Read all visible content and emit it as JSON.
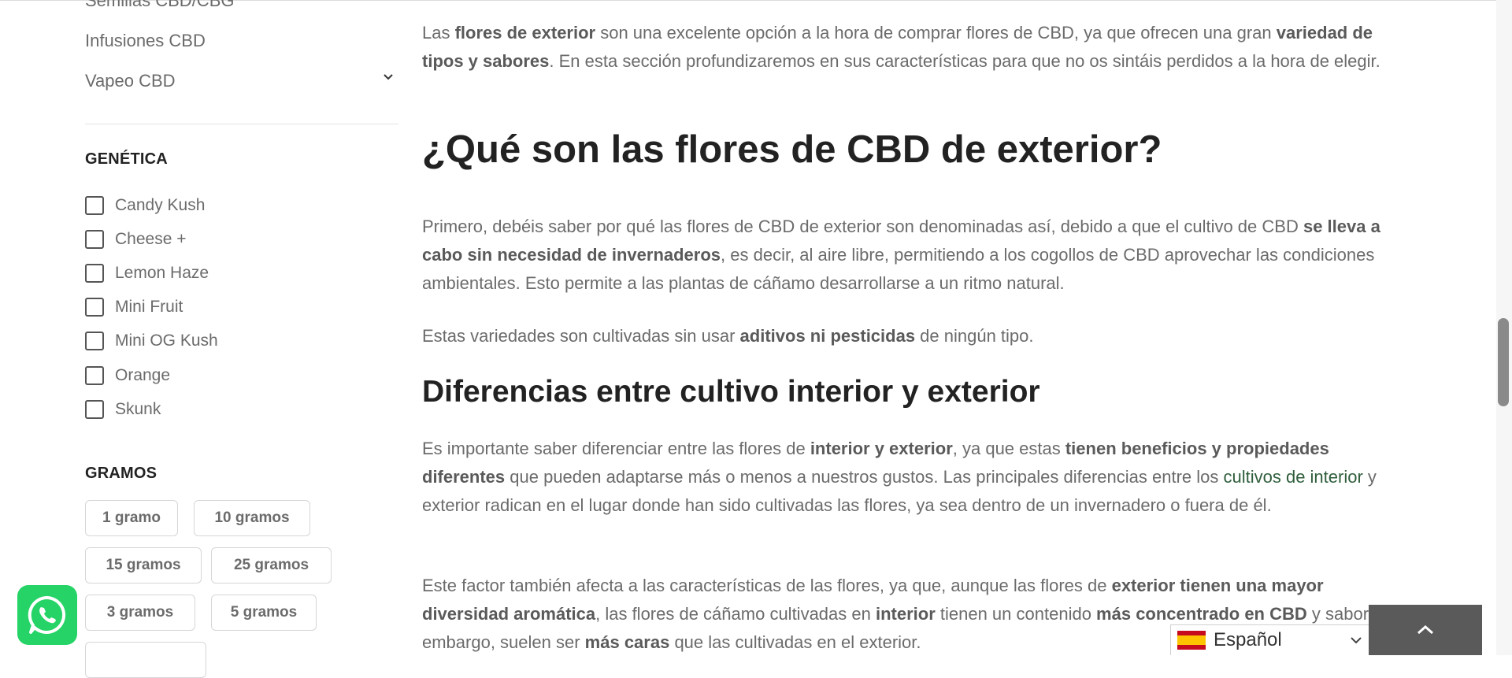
{
  "sidebar": {
    "categories": [
      {
        "label": "Semillas CBD/CBG"
      },
      {
        "label": "Infusiones CBD"
      },
      {
        "label": "Vapeo CBD"
      }
    ],
    "genetica": {
      "title": "GENÉTICA",
      "options": [
        "Candy Kush",
        "Cheese +",
        "Lemon Haze",
        "Mini Fruit",
        "Mini OG Kush",
        "Orange",
        "Skunk"
      ]
    },
    "gramos": {
      "title": "GRAMOS",
      "chips": [
        "1 gramo",
        "10 gramos",
        "15 gramos",
        "25 gramos",
        "3 gramos",
        "5 gramos"
      ]
    }
  },
  "content": {
    "intro": {
      "t1": "Las ",
      "b1": "flores de exterior",
      "t2": " son una excelente opción a la hora de comprar flores de CBD, ya que ofrecen una gran ",
      "b2": "variedad de tipos y sabores",
      "t3": ". En esta sección profundizaremos en sus características para que no os sintáis perdidos a la hora de elegir."
    },
    "h_que_son": "¿Qué son las flores de CBD de exterior?",
    "p_primero": {
      "t1": "Primero, debéis saber por qué las flores de CBD de exterior son denominadas así, debido a que el cultivo de CBD ",
      "b1": "se lleva a cabo sin necesidad de invernaderos",
      "t2": ", es decir, al aire libre, permitiendo a los cogollos de CBD aprovechar las condiciones ambientales. Esto permite a las plantas de cáñamo desarrollarse a un ritmo natural."
    },
    "p_variedades": {
      "t1": "Estas variedades son cultivadas sin usar ",
      "b1": "aditivos ni pesticidas",
      "t2": " de ningún tipo."
    },
    "h_diferencias": "Diferencias entre cultivo interior y exterior",
    "p_importante": {
      "t1": "Es importante saber diferenciar entre las flores de ",
      "b1": "interior y exterior",
      "t2": ", ya que estas ",
      "b2": "tienen beneficios y propiedades diferentes",
      "t3": " que pueden adaptarse más o menos a nuestros gustos. Las principales diferencias entre los ",
      "link": "cultivos de interior",
      "t4": " y exterior radican en el lugar donde han sido cultivadas las flores, ya sea dentro de un invernadero o fuera de él."
    },
    "p_factor": {
      "t1": "Este factor también afecta a las características de las flores, ya que, aunque las flores de ",
      "b1": "exterior tienen una mayor diversidad aromática",
      "t2": ", las flores de cáñamo cultivadas en ",
      "b2": "interior",
      "t3": " tienen un contenido ",
      "b3": "más concentrado en CBD",
      "t4": " y sabor. Sin embargo, suelen ser ",
      "b4": "más caras",
      "t5": " que las cultivadas en el exterior."
    }
  },
  "language_selector": {
    "label": "Español",
    "flag": "spain-flag-icon"
  },
  "icons": {
    "whatsapp": "whatsapp-icon",
    "back_to_top": "chevron-up-icon",
    "expand": "chevron-down-icon"
  },
  "colors": {
    "accent_link": "#2f5e3c",
    "whatsapp": "#25d366",
    "back_to_top": "#5a5a5a"
  }
}
